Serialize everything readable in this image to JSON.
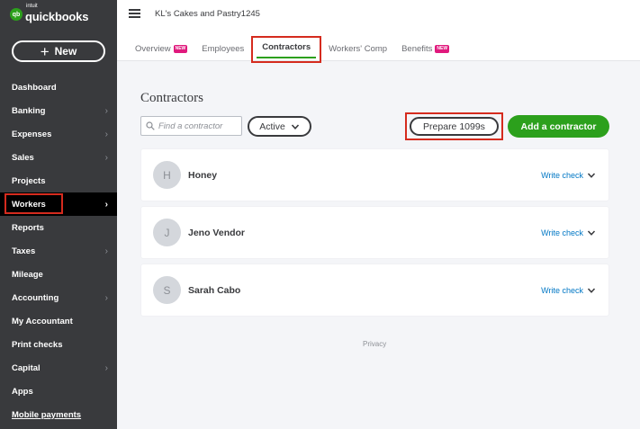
{
  "app": {
    "logo_intuit": "intuit",
    "logo_text": "quickbooks",
    "logo_mark": "qb",
    "company_name": "KL's Cakes and Pastry1245"
  },
  "sidebar": {
    "new_label": "New",
    "items": [
      {
        "label": "Dashboard",
        "chevron": false
      },
      {
        "label": "Banking",
        "chevron": true
      },
      {
        "label": "Expenses",
        "chevron": true
      },
      {
        "label": "Sales",
        "chevron": true
      },
      {
        "label": "Projects",
        "chevron": false
      },
      {
        "label": "Workers",
        "chevron": true,
        "active": true
      },
      {
        "label": "Reports",
        "chevron": false
      },
      {
        "label": "Taxes",
        "chevron": true
      },
      {
        "label": "Mileage",
        "chevron": false
      },
      {
        "label": "Accounting",
        "chevron": true
      },
      {
        "label": "My Accountant",
        "chevron": false
      },
      {
        "label": "Print checks",
        "chevron": false
      },
      {
        "label": "Capital",
        "chevron": true
      },
      {
        "label": "Apps",
        "chevron": false
      },
      {
        "label": "Mobile payments",
        "chevron": false
      }
    ]
  },
  "tabs": [
    {
      "label": "Overview",
      "badge": "NEW"
    },
    {
      "label": "Employees",
      "badge": ""
    },
    {
      "label": "Contractors",
      "badge": "",
      "active": true
    },
    {
      "label": "Workers' Comp",
      "badge": ""
    },
    {
      "label": "Benefits",
      "badge": "NEW"
    }
  ],
  "main": {
    "title": "Contractors",
    "search_placeholder": "Find a contractor",
    "filter_label": "Active",
    "prepare_label": "Prepare 1099s",
    "add_label": "Add a contractor",
    "privacy": "Privacy"
  },
  "contractors": [
    {
      "initial": "H",
      "name": "Honey",
      "action": "Write check"
    },
    {
      "initial": "J",
      "name": "Jeno Vendor",
      "action": "Write check"
    },
    {
      "initial": "S",
      "name": "Sarah Cabo",
      "action": "Write check"
    }
  ],
  "colors": {
    "brand_green": "#2ca01c",
    "sidebar_bg": "#393a3d",
    "highlight_red": "#d52b1e",
    "link_blue": "#0077c5",
    "badge_pink": "#e0197d"
  },
  "icons": {
    "menu": "hamburger-icon",
    "search": "search-icon",
    "chevron_down": "chevron-down-icon",
    "chevron_right": "chevron-right-icon",
    "plus": "plus-icon"
  }
}
